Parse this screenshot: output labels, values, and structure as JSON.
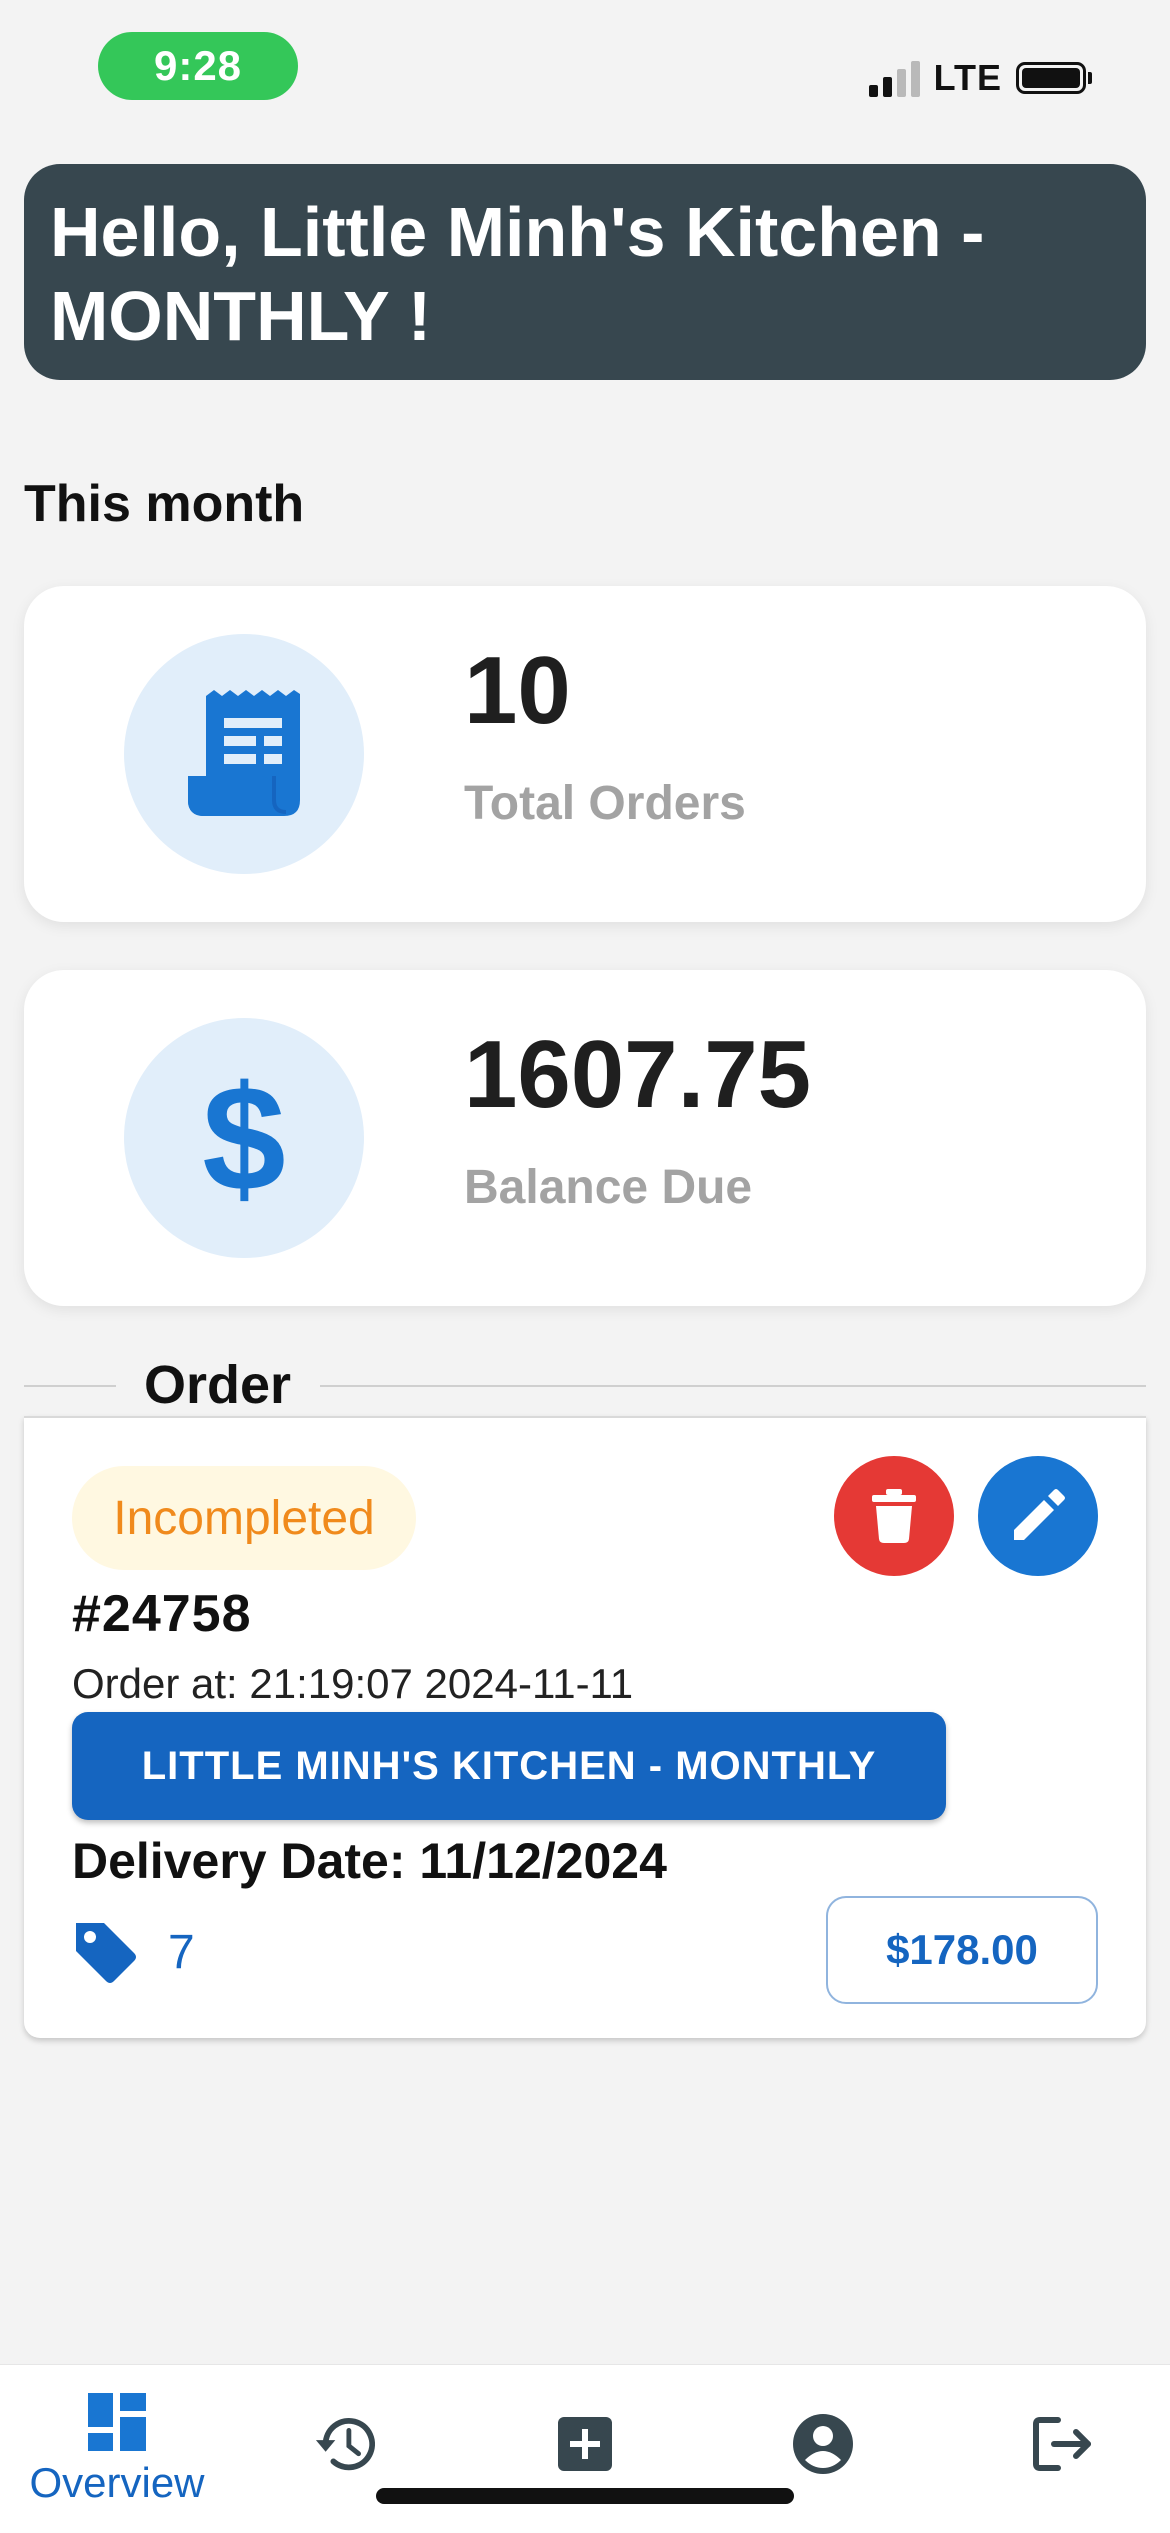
{
  "status_bar": {
    "time": "9:28",
    "network": "LTE"
  },
  "greeting": {
    "text": "Hello, Little Minh's Kitchen - MONTHLY !"
  },
  "summary": {
    "section_title": "This month",
    "total_orders": {
      "value": "10",
      "label": "Total Orders",
      "icon": "receipt-icon"
    },
    "balance_due": {
      "value": "1607.75",
      "label": "Balance Due",
      "icon": "dollar-icon",
      "symbol": "$"
    }
  },
  "orders_section": {
    "title": "Order"
  },
  "order": {
    "status": "Incompleted",
    "id": "#24758",
    "order_at": "Order at: 21:19:07 2024-11-11",
    "customer": "LITTLE MINH'S KITCHEN - MONTHLY",
    "delivery_date": "Delivery Date: 11/12/2024",
    "item_count": "7",
    "total": "$178.00"
  },
  "nav": {
    "items": [
      {
        "label": "Overview",
        "icon": "dashboard-icon",
        "active": true
      },
      {
        "label": "",
        "icon": "history-icon",
        "active": false
      },
      {
        "label": "",
        "icon": "add-box-icon",
        "active": false
      },
      {
        "label": "",
        "icon": "account-circle-icon",
        "active": false
      },
      {
        "label": "",
        "icon": "logout-icon",
        "active": false
      }
    ]
  },
  "colors": {
    "banner": "#37474f",
    "primary": "#1565c0",
    "accent_blue": "#1976d2",
    "danger": "#e53935",
    "status_warning_text": "#f08a1c",
    "status_warning_bg": "#fff8e1",
    "time_pill": "#34c759",
    "icon_circle_bg": "#e1eefa"
  }
}
